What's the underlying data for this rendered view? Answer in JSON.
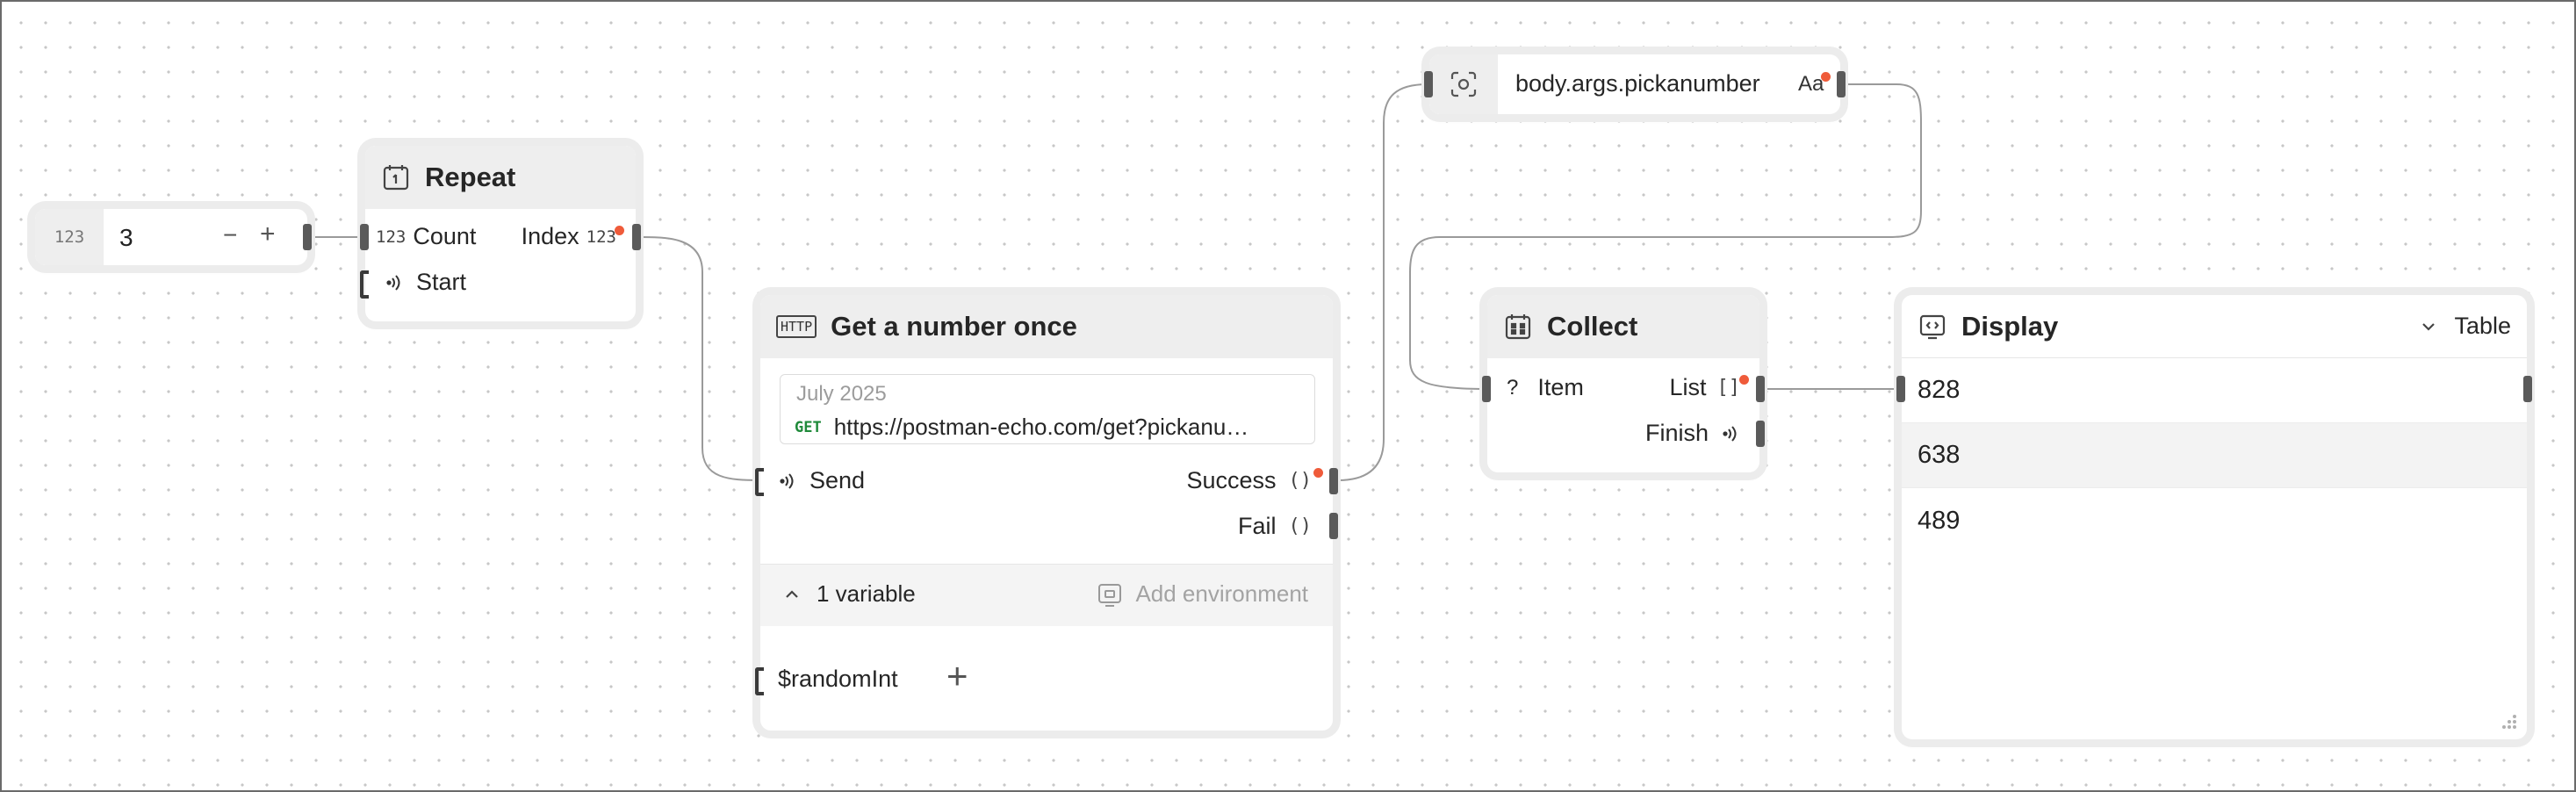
{
  "number_input": {
    "type_badge": "123",
    "value": "3",
    "minus": "−",
    "plus": "+"
  },
  "repeat": {
    "title": "Repeat",
    "count_badge": "123",
    "count_label": "Count",
    "index_label": "Index",
    "index_badge": "123",
    "start_label": "Start"
  },
  "http": {
    "icon_text": "HTTP",
    "title": "Get a number once",
    "date": "July 2025",
    "method": "GET",
    "url": "https://postman-echo.com/get?pickanu…",
    "send_label": "Send",
    "success_label": "Success",
    "success_badge": "()",
    "fail_label": "Fail",
    "fail_badge": "()",
    "variables_label": "1 variable",
    "add_env_label": "Add environment",
    "variable_name": "$randomInt",
    "add_variable": "+"
  },
  "extract": {
    "path": "body.args.pickanumber",
    "type_badge": "Aa"
  },
  "collect": {
    "title": "Collect",
    "item_badge": "?",
    "item_label": "Item",
    "list_label": "List",
    "list_badge": "[]",
    "finish_label": "Finish"
  },
  "display": {
    "title": "Display",
    "view_mode": "Table",
    "rows": [
      "828",
      "638",
      "489"
    ]
  },
  "colors": {
    "accent_dot": "#ef5b3a",
    "get_method": "#1f8a3a",
    "wire": "#9a9a9a"
  }
}
